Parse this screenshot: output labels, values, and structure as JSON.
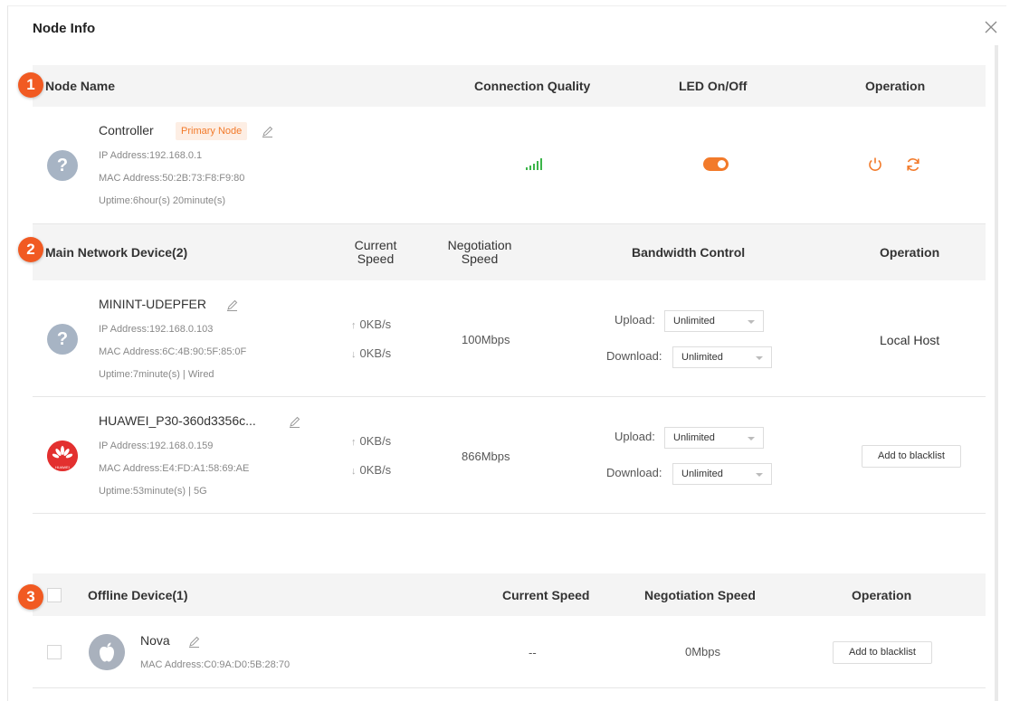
{
  "dialog": {
    "title": "Node Info"
  },
  "colors": {
    "accent": "#f27a2a",
    "step_badge": "#f15a22",
    "signal": "#3cb54a",
    "header_bg": "#f4f4f4"
  },
  "steps": [
    "1",
    "2",
    "3"
  ],
  "node_section": {
    "headers": {
      "node_name": "Node Name",
      "connection_quality": "Connection Quality",
      "led": "LED On/Off",
      "operation": "Operation"
    },
    "node": {
      "avatar_glyph": "?",
      "name": "Controller",
      "badge": "Primary Node",
      "ip": "IP Address:192.168.0.1",
      "mac": "MAC Address:50:2B:73:F8:F9:80",
      "uptime": "Uptime:6hour(s) 20minute(s)",
      "signal_icon": "signal-bars-icon",
      "led_on": true
    }
  },
  "main_section": {
    "headers": {
      "device": "Main Network Device(2)",
      "current_speed": "Current Speed",
      "negotiation_speed": "Negotiation Speed",
      "bandwidth": "Bandwidth Control",
      "operation": "Operation"
    },
    "upload_label": "Upload:",
    "download_label": "Download:",
    "devices": [
      {
        "avatar_glyph": "?",
        "name": "MININT-UDEPFER",
        "ip": "IP Address:192.168.0.103",
        "mac": "MAC Address:6C:4B:90:5F:85:0F",
        "uptime": "Uptime:7minute(s) | Wired",
        "up_speed": "0KB/s",
        "down_speed": "0KB/s",
        "negotiation": "100Mbps",
        "upload_limit": "Unlimited",
        "download_limit": "Unlimited",
        "operation": "Local Host"
      },
      {
        "avatar_brand": "HUAWEI",
        "name": "HUAWEI_P30-360d3356c...",
        "ip": "IP Address:192.168.0.159",
        "mac": "MAC Address:E4:FD:A1:58:69:AE",
        "uptime": "Uptime:53minute(s) | 5G",
        "up_speed": "0KB/s",
        "down_speed": "0KB/s",
        "negotiation": "866Mbps",
        "upload_limit": "Unlimited",
        "download_limit": "Unlimited",
        "operation": "Add to blacklist"
      }
    ]
  },
  "offline_section": {
    "headers": {
      "device": "Offline Device(1)",
      "current_speed": "Current Speed",
      "negotiation_speed": "Negotiation Speed",
      "operation": "Operation"
    },
    "devices": [
      {
        "name": "Nova",
        "mac": "MAC Address:C0:9A:D0:5B:28:70",
        "current_speed": "--",
        "negotiation": "0Mbps",
        "operation": "Add to blacklist"
      }
    ]
  }
}
